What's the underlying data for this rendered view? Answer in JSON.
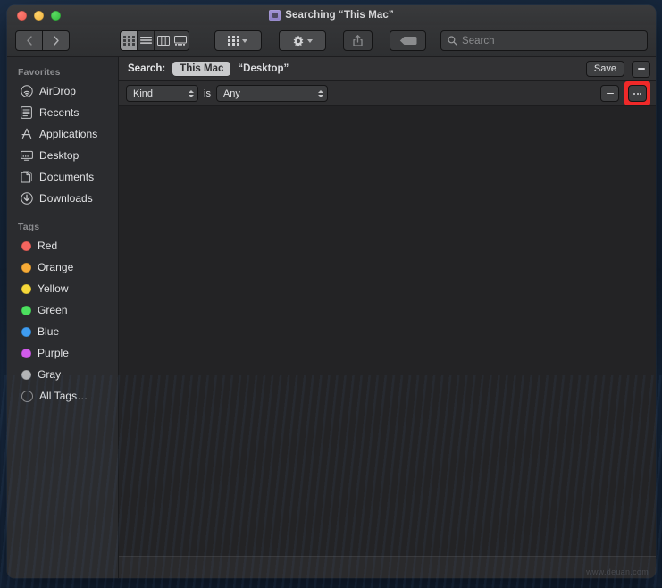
{
  "window": {
    "title": "Searching “This Mac”",
    "title_icon": "search-folder-icon",
    "traffic_lights": {
      "close": "close-button",
      "minimize": "minimize-button",
      "zoom": "zoom-button"
    }
  },
  "toolbar": {
    "back_label": "‹",
    "forward_label": "›",
    "view_modes": [
      {
        "name": "icon-view",
        "label": "Icon view",
        "active": true
      },
      {
        "name": "list-view",
        "label": "List view",
        "active": false
      },
      {
        "name": "column-view",
        "label": "Column view",
        "active": false
      },
      {
        "name": "gallery-view",
        "label": "Gallery view",
        "active": false
      }
    ],
    "group_button": "Group items",
    "action_button": "Action",
    "share_button": "Share",
    "tag_button": "Edit tags"
  },
  "search": {
    "placeholder": "Search",
    "value": "",
    "icon": "magnifier-icon"
  },
  "sidebar": {
    "sections": [
      {
        "header": "Favorites",
        "items": [
          {
            "label": "AirDrop",
            "icon": "airdrop-icon"
          },
          {
            "label": "Recents",
            "icon": "recents-icon"
          },
          {
            "label": "Applications",
            "icon": "applications-icon"
          },
          {
            "label": "Desktop",
            "icon": "desktop-icon"
          },
          {
            "label": "Documents",
            "icon": "documents-icon"
          },
          {
            "label": "Downloads",
            "icon": "downloads-icon"
          }
        ]
      },
      {
        "header": "Tags",
        "items": [
          {
            "label": "Red",
            "icon": "tag-dot-icon",
            "color": "#f4655f"
          },
          {
            "label": "Orange",
            "icon": "tag-dot-icon",
            "color": "#f6ab37"
          },
          {
            "label": "Yellow",
            "icon": "tag-dot-icon",
            "color": "#f6d83a"
          },
          {
            "label": "Green",
            "icon": "tag-dot-icon",
            "color": "#4ce05f"
          },
          {
            "label": "Blue",
            "icon": "tag-dot-icon",
            "color": "#3f9cf0"
          },
          {
            "label": "Purple",
            "icon": "tag-dot-icon",
            "color": "#d25bec"
          },
          {
            "label": "Gray",
            "icon": "tag-dot-icon",
            "color": "#b3b4b6"
          },
          {
            "label": "All Tags…",
            "icon": "all-tags-icon",
            "color": "hollow"
          }
        ]
      }
    ]
  },
  "scope_bar": {
    "label": "Search:",
    "scopes": [
      {
        "label": "This Mac",
        "selected": true
      },
      {
        "label": "“Desktop”",
        "selected": false
      }
    ],
    "save_label": "Save",
    "remove_label": "−"
  },
  "criteria": {
    "rows": [
      {
        "attribute": "Kind",
        "operator": "is",
        "value": "Any",
        "remove_label": "−",
        "more_label": "⋯",
        "more_highlighted": true
      }
    ]
  },
  "results": {
    "items": [],
    "status": ""
  },
  "watermark": "www.deuan.com",
  "colors": {
    "accent_highlight": "#ef2929",
    "window_bg": "#272729",
    "sidebar_bg": "#2b2c2f",
    "content_bg": "#232325"
  }
}
